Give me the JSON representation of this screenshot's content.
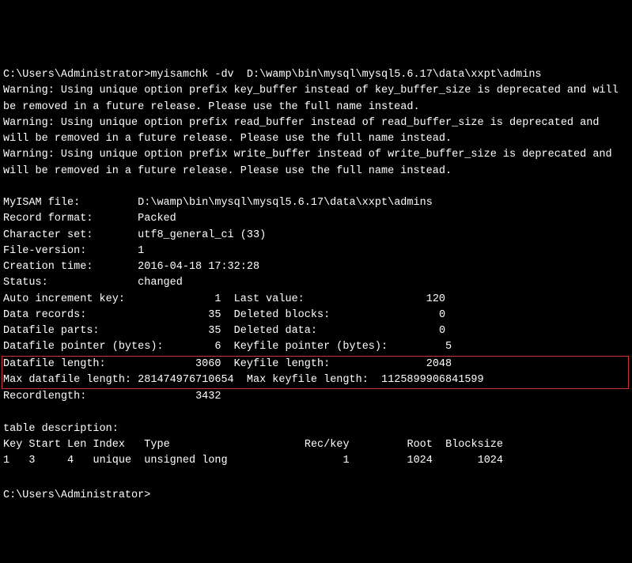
{
  "prompt1": "C:\\Users\\Administrator>",
  "command": "myisamchk -dv  D:\\wamp\\bin\\mysql\\mysql5.6.17\\data\\xxpt\\admins",
  "warning1": "Warning: Using unique option prefix key_buffer instead of key_buffer_size is deprecated and will be removed in a future release. Please use the full name instead.",
  "warning2": "Warning: Using unique option prefix read_buffer instead of read_buffer_size is deprecated and will be removed in a future release. Please use the full name instead.",
  "warning3": "Warning: Using unique option prefix write_buffer instead of write_buffer_size is deprecated and will be removed in a future release. Please use the full name instead.",
  "info": {
    "myisam_file_label": "MyISAM file:",
    "myisam_file_value": "D:\\wamp\\bin\\mysql\\mysql5.6.17\\data\\xxpt\\admins",
    "record_format_label": "Record format:",
    "record_format_value": "Packed",
    "charset_label": "Character set:",
    "charset_value": "utf8_general_ci (33)",
    "file_version_label": "File-version:",
    "file_version_value": "1",
    "creation_time_label": "Creation time:",
    "creation_time_value": "2016-04-18 17:32:28",
    "status_label": "Status:",
    "status_value": "changed",
    "auto_inc_label": "Auto increment key:",
    "auto_inc_value": "1",
    "last_value_label": "Last value:",
    "last_value_value": "120",
    "data_records_label": "Data records:",
    "data_records_value": "35",
    "deleted_blocks_label": "Deleted blocks:",
    "deleted_blocks_value": "0",
    "datafile_parts_label": "Datafile parts:",
    "datafile_parts_value": "35",
    "deleted_data_label": "Deleted data:",
    "deleted_data_value": "0",
    "datafile_pointer_label": "Datafile pointer (bytes):",
    "datafile_pointer_value": "6",
    "keyfile_pointer_label": "Keyfile pointer (bytes):",
    "keyfile_pointer_value": "5",
    "datafile_length_label": "Datafile length:",
    "datafile_length_value": "3060",
    "keyfile_length_label": "Keyfile length:",
    "keyfile_length_value": "2048",
    "max_datafile_length_label": "Max datafile length:",
    "max_datafile_length_value": "281474976710654",
    "max_keyfile_length_label": "Max keyfile length:",
    "max_keyfile_length_value": "1125899906841599",
    "recordlength_label": "Recordlength:",
    "recordlength_value": "3432"
  },
  "table_desc_label": "table description:",
  "table_header": {
    "key": "Key",
    "start": "Start",
    "len": "Len",
    "index": "Index",
    "type": "Type",
    "rec_key": "Rec/key",
    "root": "Root",
    "blocksize": "Blocksize"
  },
  "table_row": {
    "key": "1",
    "start": "3",
    "len": "4",
    "index": "unique",
    "type": "unsigned long",
    "rec_key": "1",
    "root": "1024",
    "blocksize": "1024"
  },
  "prompt2": "C:\\Users\\Administrator>"
}
